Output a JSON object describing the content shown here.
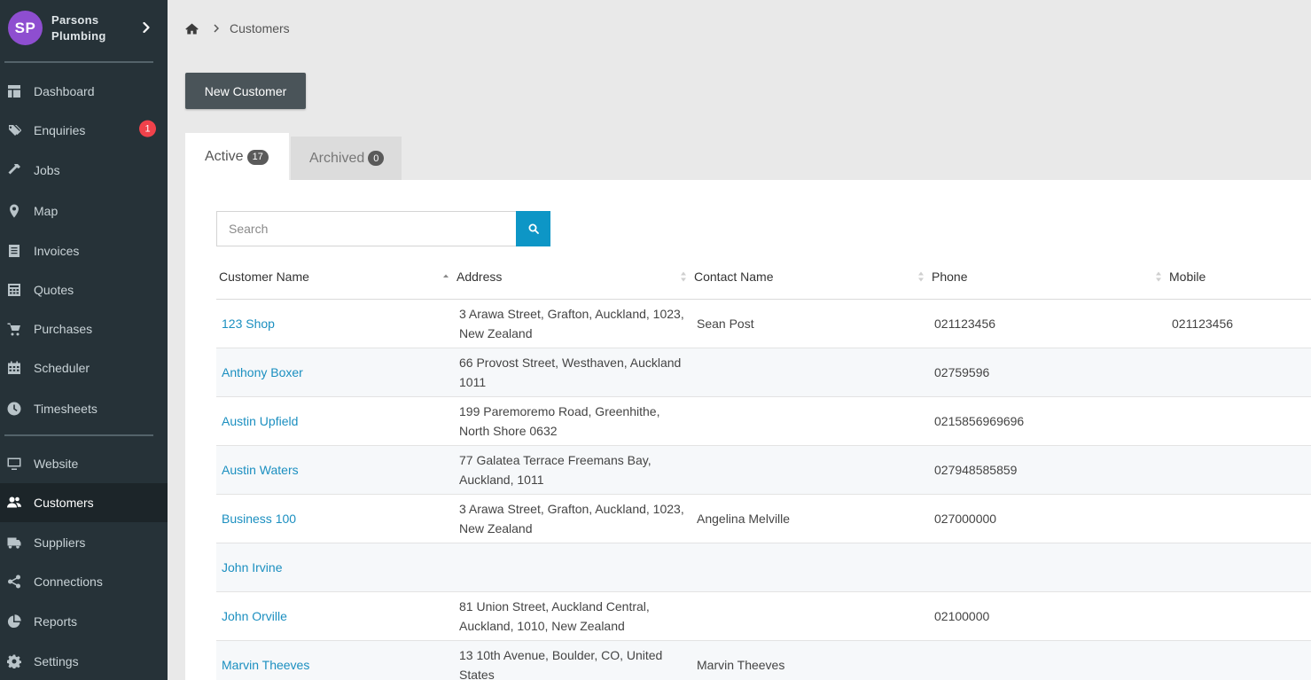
{
  "brand": {
    "initials": "SP",
    "name": "Parsons Plumbing"
  },
  "sidebar": {
    "items": [
      {
        "label": "Dashboard",
        "icon": "dashboard-icon"
      },
      {
        "label": "Enquiries",
        "icon": "tags-icon",
        "badge": "1"
      },
      {
        "label": "Jobs",
        "icon": "hammer-icon"
      },
      {
        "label": "Map",
        "icon": "map-marker-icon"
      },
      {
        "label": "Invoices",
        "icon": "invoice-icon"
      },
      {
        "label": "Quotes",
        "icon": "calculator-icon"
      },
      {
        "label": "Purchases",
        "icon": "cart-icon"
      },
      {
        "label": "Scheduler",
        "icon": "calendar-icon"
      },
      {
        "label": "Timesheets",
        "icon": "clock-icon"
      },
      {
        "label": "Website",
        "icon": "monitor-icon"
      },
      {
        "label": "Customers",
        "icon": "users-icon",
        "active": true
      },
      {
        "label": "Suppliers",
        "icon": "truck-icon"
      },
      {
        "label": "Connections",
        "icon": "share-icon"
      },
      {
        "label": "Reports",
        "icon": "pie-chart-icon"
      },
      {
        "label": "Settings",
        "icon": "gear-icon"
      }
    ]
  },
  "breadcrumb": {
    "current": "Customers"
  },
  "toolbar": {
    "new_customer_label": "New Customer"
  },
  "tabs": [
    {
      "label": "Active",
      "count": "17",
      "active": true
    },
    {
      "label": "Archived",
      "count": "0",
      "active": false
    }
  ],
  "search": {
    "placeholder": "Search"
  },
  "table": {
    "columns": [
      "Customer Name",
      "Address",
      "Contact Name",
      "Phone",
      "Mobile"
    ],
    "rows": [
      {
        "name": "123 Shop",
        "address": "3 Arawa Street, Grafton, Auckland, 1023, New Zealand",
        "contact": "Sean Post",
        "phone": "021123456",
        "mobile": "021123456"
      },
      {
        "name": "Anthony Boxer",
        "address": "66 Provost Street, Westhaven, Auckland 1011",
        "contact": "",
        "phone": "02759596",
        "mobile": ""
      },
      {
        "name": "Austin Upfield",
        "address": "199 Paremoremo Road, Greenhithe, North Shore 0632",
        "contact": "",
        "phone": "0215856969696",
        "mobile": ""
      },
      {
        "name": "Austin Waters",
        "address": "77 Galatea Terrace Freemans Bay, Auckland, 1011",
        "contact": "",
        "phone": "027948585859",
        "mobile": ""
      },
      {
        "name": "Business 100",
        "address": "3 Arawa Street, Grafton, Auckland, 1023, New Zealand",
        "contact": "Angelina Melville",
        "phone": "027000000",
        "mobile": ""
      },
      {
        "name": "John Irvine",
        "address": "",
        "contact": "",
        "phone": "",
        "mobile": ""
      },
      {
        "name": "John Orville",
        "address": "81 Union Street, Auckland Central, Auckland, 1010, New Zealand",
        "contact": "",
        "phone": "02100000",
        "mobile": ""
      },
      {
        "name": "Marvin Theeves",
        "address": "13 10th Avenue, Boulder, CO, United States",
        "contact": "Marvin Theeves",
        "phone": "",
        "mobile": ""
      }
    ]
  },
  "colors": {
    "sidebar_bg": "#263238",
    "link": "#1b8fc0",
    "search_button": "#0d96c6",
    "badge": "#f0424b",
    "avatar": "#8e4ed0"
  }
}
